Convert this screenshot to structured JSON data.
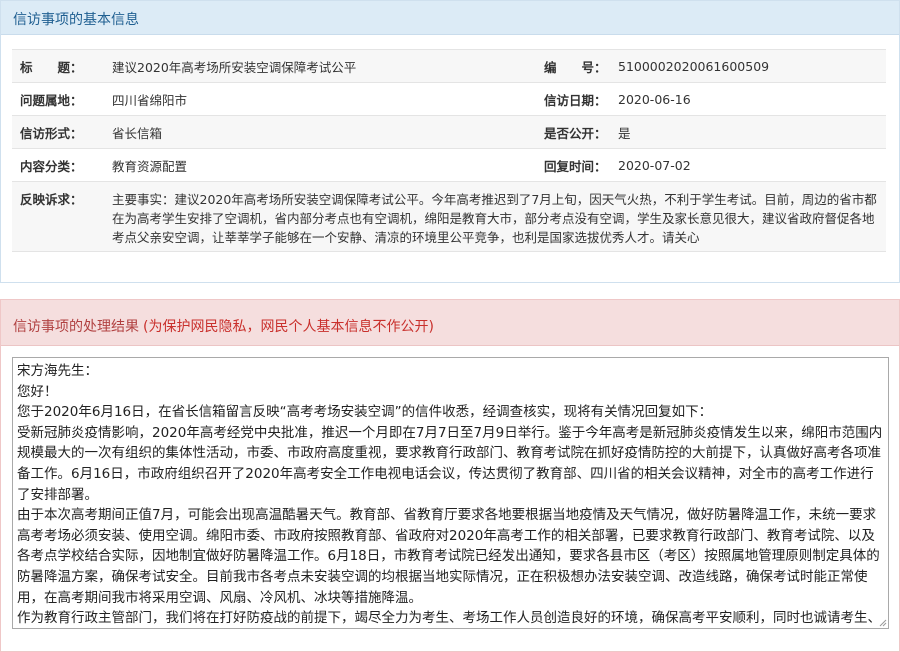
{
  "info_section": {
    "title": "信访事项的基本信息",
    "rows": [
      {
        "label1": "标　　题：",
        "value1": "建议2020年高考场所安装空调保障考试公平",
        "label2": "编　　号：",
        "value2": "5100002020061600509"
      },
      {
        "label1": "问题属地：",
        "value1": "四川省绵阳市",
        "label2": "信访日期：",
        "value2": "2020-06-16"
      },
      {
        "label1": "信访形式：",
        "value1": "省长信箱",
        "label2": "是否公开：",
        "value2": "是"
      },
      {
        "label1": "内容分类：",
        "value1": "教育资源配置",
        "label2": "回复时间：",
        "value2": "2020-07-02"
      }
    ],
    "appeal_label": "反映诉求：",
    "appeal_text": "主要事实：建议2020年高考场所安装空调保障考试公平。今年高考推迟到了7月上旬，因天气火热，不利于学生考试。目前，周边的省市都在为高考学生安排了空调机，省内部分考点也有空调机，绵阳是教育大市，部分考点没有空调，学生及家长意见很大，建议省政府督促各地考点父亲安空调，让莘莘学子能够在一个安静、清凉的环境里公平竞争，也利是国家选拔优秀人才。请关心"
  },
  "result_section": {
    "title": "信访事项的处理结果",
    "note": "(为保护网民隐私，网民个人基本信息不作公开)",
    "reply_paragraphs": [
      "宋方海先生：",
      "您好！",
      "您于2020年6月16日，在省长信箱留言反映“高考考场安装空调”的信件收悉，经调查核实，现将有关情况回复如下：",
      "受新冠肺炎疫情影响，2020年高考经党中央批准，推迟一个月即在7月7日至7月9日举行。鉴于今年高考是新冠肺炎疫情发生以来，绵阳市范围内规模最大的一次有组织的集体性活动，市委、市政府高度重视，要求教育行政部门、教育考试院在抓好疫情防控的大前提下，认真做好高考各项准备工作。6月16日，市政府组织召开了2020年高考安全工作电视电话会议，传达贯彻了教育部、四川省的相关会议精神，对全市的高考工作进行了安排部署。",
      "由于本次高考期间正值7月，可能会出现高温酷暑天气。教育部、省教育厅要求各地要根据当地疫情及天气情况，做好防暑降温工作，未统一要求高考考场必须安装、使用空调。绵阳市委、市政府按照教育部、省政府对2020年高考工作的相关部署，已要求教育行政部门、教育考试院、以及各考点学校结合实际，因地制宜做好防暑降温工作。6月18日，市教育考试院已经发出通知，要求各县市区（考区）按照属地管理原则制定具体的防暑降温方案，确保考试安全。目前我市各考点未安装空调的均根据当地实际情况，正在积极想办法安装空调、改造线路，确保考试时能正常使用，在高考期间我市将采用空调、风扇、冷风机、冰块等措施降温。",
      "作为教育行政主管部门，我们将在打好防疫战的前提下，竭尽全力为考生、考场工作人员创造良好的环境，确保高考平安顺利，同时也诚请考生、家长理解、支持今年在特殊背景下的高考。"
    ]
  },
  "colors": {
    "info_header_bg": "#dcebf6",
    "info_header_text": "#1f5f91",
    "result_header_bg": "#f5dede",
    "result_header_text": "#b14141",
    "privacy_note_text": "#c9302c"
  }
}
